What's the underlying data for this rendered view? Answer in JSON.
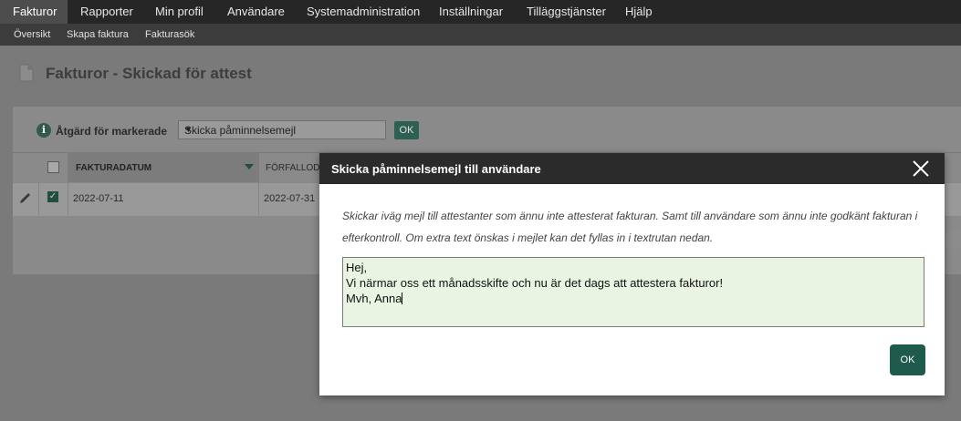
{
  "nav": {
    "items": [
      "Fakturor",
      "Rapporter",
      "Min profil",
      "Användare",
      "Systemadministration",
      "Inställningar",
      "Tilläggstjänster",
      "Hjälp"
    ],
    "active": "Fakturor"
  },
  "subnav": {
    "items": [
      "Översikt",
      "Skapa faktura",
      "Fakturasök"
    ]
  },
  "page": {
    "title": "Fakturor - Skickad för attest",
    "icon": "document-icon"
  },
  "action_bar": {
    "label": "Åtgärd för markerade",
    "selected": "Skicka påminnelsemejl",
    "ok_label": "OK"
  },
  "table": {
    "columns": [
      "FAKTURADATUM",
      "FÖRFALLODA"
    ],
    "rows": [
      {
        "checked": true,
        "fakturadatum": "2022-07-11",
        "forfallodatum": "2022-07-31"
      }
    ]
  },
  "modal": {
    "title": "Skicka påminnelsemejl till användare",
    "description": "Skickar iväg mejl till attestanter som ännu inte attesterat fakturan. Samt till användare som ännu inte godkänt fakturan i efterkontroll. Om extra text önskas i mejlet kan det fyllas in i textrutan nedan.",
    "message_lines": [
      "Hej,",
      "Vi närmar oss ett månadsskifte och nu är det dags att attestera fakturor!",
      "Mvh, Anna"
    ],
    "ok_label": "OK"
  },
  "colors": {
    "accent": "#1e5b4d",
    "textarea_bg": "#eaf4e2",
    "header_bg": "#2b2b2b"
  }
}
